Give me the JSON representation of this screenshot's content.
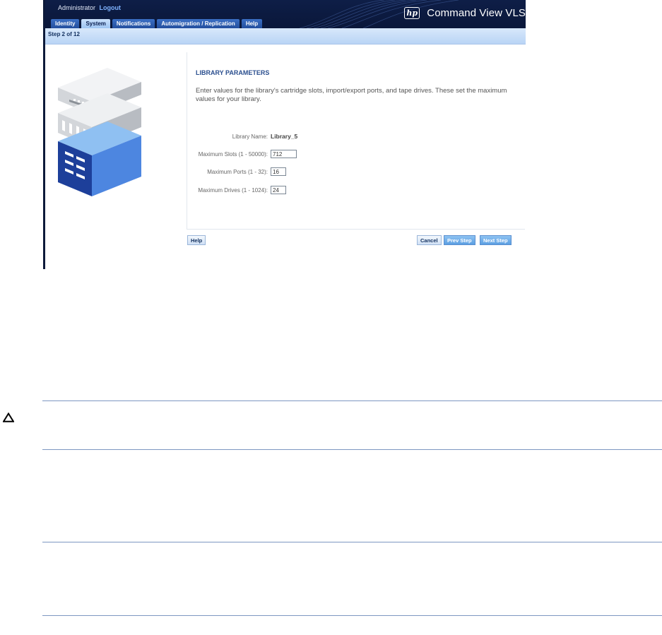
{
  "app": {
    "user": "Administrator",
    "logout": "Logout",
    "product": "Command View VLS",
    "logo_text": "hp"
  },
  "tabs": [
    {
      "label": "Identity",
      "active": false
    },
    {
      "label": "System",
      "active": true
    },
    {
      "label": "Notifications",
      "active": false
    },
    {
      "label": "Automigration / Replication",
      "active": false
    },
    {
      "label": "Help",
      "active": false
    }
  ],
  "wizard": {
    "step": "Step 2 of 12",
    "title": "LIBRARY PARAMETERS",
    "description": "Enter values for the library's cartridge slots, import/export ports, and tape drives. These set the maximum values for your library.",
    "fields": {
      "library_name": {
        "label": "Library Name:",
        "value": "Library_5"
      },
      "max_slots": {
        "label": "Maximum Slots (1 - 50000):",
        "value": "712"
      },
      "max_ports": {
        "label": "Maximum Ports (1 - 32):",
        "value": "16"
      },
      "max_drives": {
        "label": "Maximum Drives (1 - 1024):",
        "value": "24"
      }
    },
    "buttons": {
      "help": "Help",
      "cancel": "Cancel",
      "prev": "Prev Step",
      "next": "Next Step"
    }
  },
  "colors": {
    "header_bg": "#0e1e47",
    "tab_bg": "#234f9e",
    "tab_active": "#9ec5f2",
    "title": "#2b4f8f",
    "rule": "#7d97c1"
  },
  "icons": {
    "caution": "caution-triangle-icon",
    "illustration": "tape-library-icon"
  }
}
